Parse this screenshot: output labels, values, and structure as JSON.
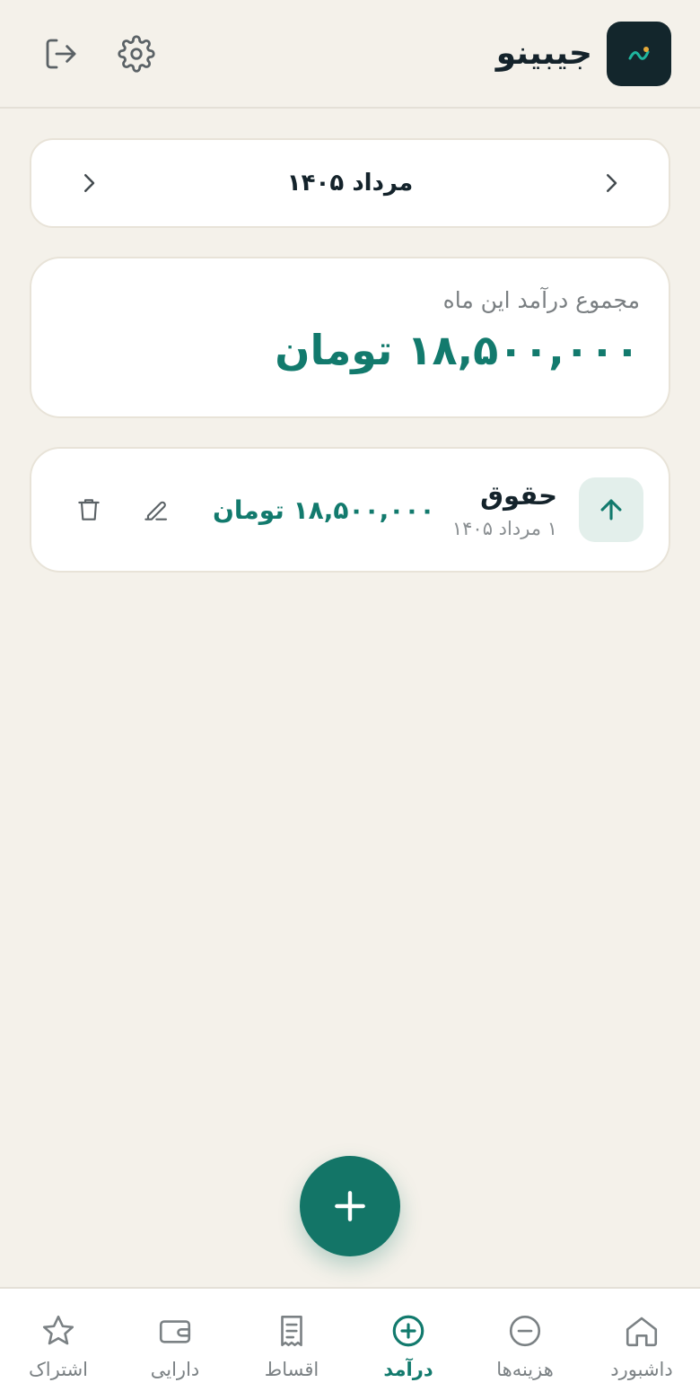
{
  "app": {
    "name": "جیبینو"
  },
  "month_selector": {
    "label": "مرداد ۱۴۰۵"
  },
  "summary": {
    "label": "مجموع درآمد این ماه",
    "value": "۱۸,۵۰۰,۰۰۰ تومان"
  },
  "income_items": [
    {
      "title": "حقوق",
      "date": "۱ مرداد ۱۴۰۵",
      "amount": "۱۸,۵۰۰,۰۰۰ تومان",
      "icon": "arrow-up-icon"
    }
  ],
  "nav": {
    "items": [
      {
        "label": "داشبورد",
        "icon": "home-icon",
        "active": false
      },
      {
        "label": "هزینه‌ها",
        "icon": "minus-circle-icon",
        "active": false
      },
      {
        "label": "درآمد",
        "icon": "plus-circle-icon",
        "active": true
      },
      {
        "label": "اقساط",
        "icon": "receipt-icon",
        "active": false
      },
      {
        "label": "دارایی",
        "icon": "wallet-icon",
        "active": false
      },
      {
        "label": "اشتراک",
        "icon": "star-icon",
        "active": false
      }
    ]
  },
  "colors": {
    "accent": "#127a6d",
    "background": "#f4f1ea",
    "logo_bg": "#13262c",
    "muted": "#7b8184"
  }
}
